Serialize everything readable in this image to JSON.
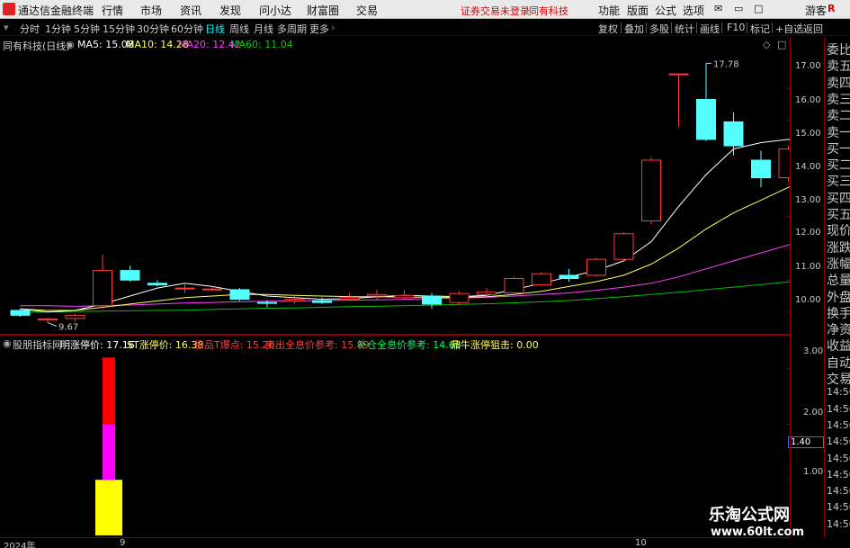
{
  "menubar": {
    "app_title": "通达信金融终端",
    "menus": [
      "行情",
      "市场",
      "资讯",
      "发现",
      "问小达",
      "财富圈",
      "交易"
    ],
    "warning": "证券交易未登录",
    "stock_name": "同有科技",
    "right_menus": [
      "功能",
      "版面",
      "公式",
      "选项"
    ],
    "guest": "游客",
    "badge": "R"
  },
  "toolbar": {
    "periods": [
      "分时",
      "1分钟",
      "5分钟",
      "15分钟",
      "30分钟",
      "60分钟",
      "日线",
      "周线",
      "月线",
      "多周期",
      "更多"
    ],
    "active_period": "日线",
    "right_buttons": [
      "复权",
      "叠加",
      "多股",
      "统计",
      "画线",
      "F10",
      "标记",
      "+自选",
      "返回"
    ]
  },
  "main_legend": {
    "title": "同有科技(日线)",
    "ma5": "MA5: 15.08",
    "ma10": "MA10: 14.28",
    "ma20": "MA20: 12.42",
    "ma60": "MA60: 11.04"
  },
  "sub_legend": {
    "name": "股朋指标网",
    "mingzhang": "明涨停价: 17.16",
    "stzhang": "ST涨停价: 16.38",
    "jipin": "极品T爆点: 15.26",
    "maichu": "卖出全息价参考: 15.89",
    "bucang": "补仓全息价参考: 14.68",
    "zhuniu": "鼎牛涨停狙击: 0.00"
  },
  "price_axis": [
    "17.00",
    "16.00",
    "15.00",
    "14.00",
    "13.00",
    "12.00",
    "11.00",
    "10.00"
  ],
  "sub_axis": [
    "3.00",
    "2.00",
    "1.00"
  ],
  "annotations": {
    "high": "17.78",
    "low": "9.67"
  },
  "quote_panel": [
    "委比",
    "卖五",
    "卖四",
    "卖三",
    "卖二",
    "卖一",
    "买一",
    "买二",
    "买三",
    "买四",
    "买五",
    "现价",
    "涨跌",
    "涨幅",
    "总量",
    "外盘",
    "换手",
    "净资",
    "收益",
    "自动",
    "交易",
    "14:56",
    "14:56",
    "14:56",
    "14:56",
    "14:56",
    "14:56",
    "14:56",
    "14:56",
    "14:56"
  ],
  "value_box": "1.40",
  "time_axis": {
    "year": "2024年",
    "m1": "9",
    "m2": "10"
  },
  "watermark": {
    "line1": "乐淘公式网",
    "line2": "www.60lt.com"
  },
  "colors": {
    "up": "#ff3c3c",
    "down": "#54ffff",
    "ma5": "#ffffff",
    "ma10": "#ffff60",
    "ma20": "#ff40ff",
    "ma60": "#00c000"
  },
  "chart_data": {
    "type": "candlestick",
    "ylim": [
      9.6,
      18.1
    ],
    "candles": [
      {
        "o": 10.05,
        "c": 9.9,
        "h": 10.1,
        "l": 9.85
      },
      {
        "o": 9.75,
        "c": 9.78,
        "h": 9.82,
        "l": 9.67
      },
      {
        "o": 9.8,
        "c": 9.9,
        "h": 9.95,
        "l": 9.7
      },
      {
        "o": 10.2,
        "c": 11.3,
        "h": 11.8,
        "l": 10.1
      },
      {
        "o": 11.3,
        "c": 11.0,
        "h": 11.45,
        "l": 10.95
      },
      {
        "o": 10.9,
        "c": 10.85,
        "h": 11.0,
        "l": 10.8
      },
      {
        "o": 10.75,
        "c": 10.75,
        "h": 10.9,
        "l": 10.6
      },
      {
        "o": 10.7,
        "c": 10.72,
        "h": 10.8,
        "l": 10.65
      },
      {
        "o": 10.7,
        "c": 10.4,
        "h": 10.75,
        "l": 10.35
      },
      {
        "o": 10.3,
        "c": 10.28,
        "h": 10.38,
        "l": 10.15
      },
      {
        "o": 10.35,
        "c": 10.4,
        "h": 10.5,
        "l": 10.25
      },
      {
        "o": 10.35,
        "c": 10.3,
        "h": 10.45,
        "l": 10.25
      },
      {
        "o": 10.4,
        "c": 10.45,
        "h": 10.6,
        "l": 10.35
      },
      {
        "o": 10.5,
        "c": 10.55,
        "h": 10.7,
        "l": 10.4
      },
      {
        "o": 10.45,
        "c": 10.52,
        "h": 10.68,
        "l": 10.38
      },
      {
        "o": 10.5,
        "c": 10.25,
        "h": 10.6,
        "l": 10.1
      },
      {
        "o": 10.3,
        "c": 10.58,
        "h": 10.65,
        "l": 10.2
      },
      {
        "o": 10.55,
        "c": 10.62,
        "h": 10.75,
        "l": 10.45
      },
      {
        "o": 10.6,
        "c": 11.05,
        "h": 11.1,
        "l": 10.55
      },
      {
        "o": 10.85,
        "c": 11.2,
        "h": 11.25,
        "l": 10.8
      },
      {
        "o": 11.15,
        "c": 11.05,
        "h": 11.35,
        "l": 10.95
      },
      {
        "o": 11.15,
        "c": 11.65,
        "h": 11.7,
        "l": 11.1
      },
      {
        "o": 11.65,
        "c": 12.45,
        "h": 12.5,
        "l": 11.6
      },
      {
        "o": 12.85,
        "c": 14.75,
        "h": 14.85,
        "l": 12.75
      },
      {
        "o": 17.45,
        "c": 17.45,
        "h": 17.45,
        "l": 15.8
      },
      {
        "o": 16.65,
        "c": 15.4,
        "h": 17.78,
        "l": 15.35
      },
      {
        "o": 15.95,
        "c": 15.2,
        "h": 16.25,
        "l": 14.9
      },
      {
        "o": 14.75,
        "c": 14.2,
        "h": 15.05,
        "l": 13.9
      },
      {
        "o": 14.2,
        "c": 15.1,
        "h": 15.2,
        "l": 14.1
      },
      {
        "o": 15.1,
        "c": 15.55,
        "h": 15.9,
        "l": 14.8
      }
    ],
    "ma5": [
      10.1,
      10.0,
      10.05,
      10.25,
      10.5,
      10.75,
      10.9,
      10.8,
      10.65,
      10.5,
      10.45,
      10.4,
      10.42,
      10.48,
      10.52,
      10.5,
      10.48,
      10.52,
      10.7,
      10.9,
      11.1,
      11.3,
      11.6,
      12.2,
      13.3,
      14.3,
      15.1,
      15.3,
      15.4,
      15.1
    ],
    "ma10": [
      10.1,
      10.05,
      10.05,
      10.15,
      10.25,
      10.35,
      10.45,
      10.5,
      10.55,
      10.55,
      10.52,
      10.5,
      10.48,
      10.48,
      10.47,
      10.46,
      10.46,
      10.48,
      10.55,
      10.65,
      10.8,
      10.95,
      11.15,
      11.5,
      12.0,
      12.6,
      13.1,
      13.5,
      13.9,
      14.28
    ],
    "ma20": [
      10.2,
      10.2,
      10.18,
      10.2,
      10.22,
      10.25,
      10.28,
      10.3,
      10.32,
      10.34,
      10.35,
      10.36,
      10.37,
      10.38,
      10.4,
      10.42,
      10.44,
      10.46,
      10.5,
      10.55,
      10.6,
      10.68,
      10.78,
      10.9,
      11.1,
      11.35,
      11.6,
      11.85,
      12.1,
      12.42
    ],
    "ma60": [
      10.0,
      10.0,
      10.02,
      10.03,
      10.04,
      10.05,
      10.06,
      10.08,
      10.1,
      10.12,
      10.13,
      10.15,
      10.17,
      10.18,
      10.2,
      10.22,
      10.24,
      10.26,
      10.29,
      10.32,
      10.36,
      10.42,
      10.48,
      10.55,
      10.62,
      10.7,
      10.78,
      10.86,
      10.94,
      11.04
    ],
    "sub_bars": {
      "ylim": [
        0,
        3.4
      ],
      "segments": [
        {
          "from": 0,
          "to": 1.0,
          "color": "#ffff00"
        },
        {
          "from": 1.0,
          "to": 2.0,
          "color": "#ff00ff"
        },
        {
          "from": 2.0,
          "to": 3.2,
          "color": "#ff0000"
        }
      ],
      "bar_index": 3
    }
  }
}
